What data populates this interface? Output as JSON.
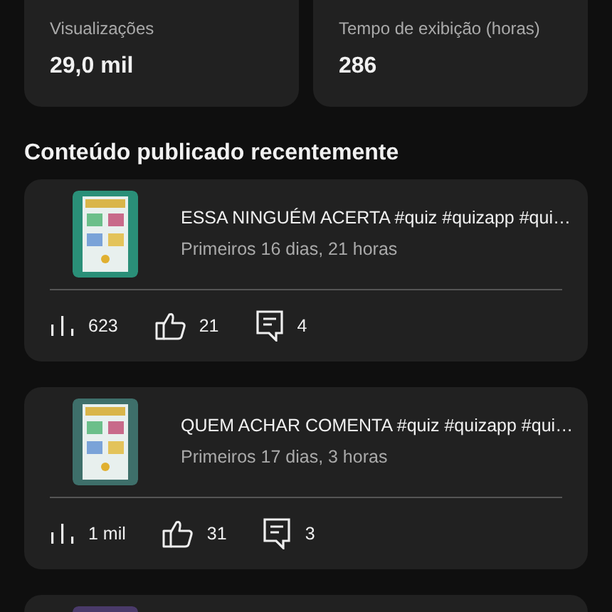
{
  "stats": [
    {
      "label": "Visualizações",
      "value": "29,0 mil"
    },
    {
      "label": "Tempo de exibição (horas)",
      "value": "286"
    }
  ],
  "section_title": "Conteúdo publicado recentemente",
  "videos": [
    {
      "thumbnail": {
        "kind": "picture"
      },
      "title": "ESSA NINGUÉM ACERTA #quiz #quizapp #qui…",
      "period": "Primeiros 16 dias, 21 horas",
      "views": "623",
      "likes": "21",
      "comments": "4"
    },
    {
      "thumbnail": {
        "kind": "picture"
      },
      "title": "QUEM ACHAR COMENTA #quiz #quizapp #qui…",
      "period": "Primeiros 17 dias, 3 horas",
      "views": "1 mil",
      "likes": "31",
      "comments": "3"
    },
    {
      "thumbnail": {
        "kind": "picture"
      }
    }
  ]
}
